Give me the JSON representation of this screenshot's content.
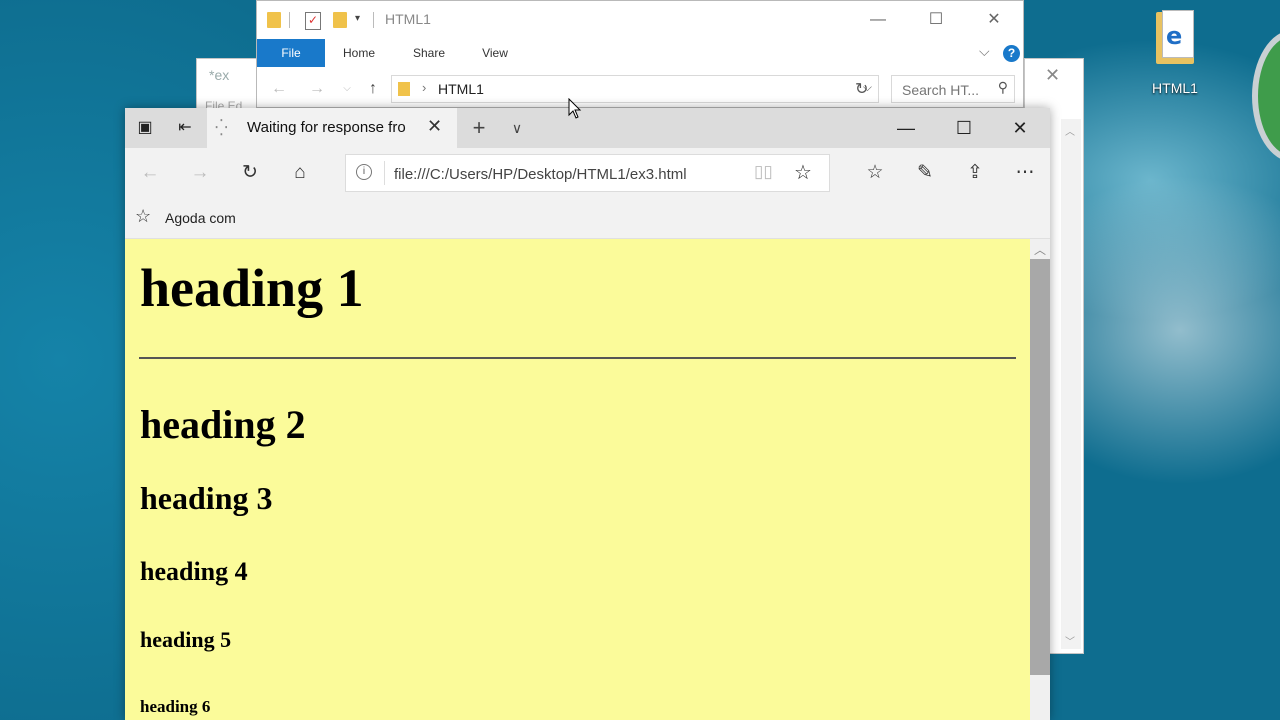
{
  "desktop": {
    "icon_label": "HTML1"
  },
  "background_window": {
    "title": "*ex",
    "menu": "File  Ed"
  },
  "explorer": {
    "title": "HTML1",
    "ribbon_tabs": [
      "File",
      "Home",
      "Share",
      "View"
    ],
    "address_crumb": "HTML1",
    "search_placeholder": "Search HT..."
  },
  "edge": {
    "tab_title": "Waiting for response fro",
    "url": "file:///C:/Users/HP/Desktop/HTML1/ex3.html",
    "favorites": [
      "Agoda com"
    ]
  },
  "page": {
    "background": "#fbfb9a",
    "h1": "heading 1",
    "h2": "heading 2",
    "h3": "heading 3",
    "h4": "heading 4",
    "h5": "heading 5",
    "h6": "heading 6"
  }
}
